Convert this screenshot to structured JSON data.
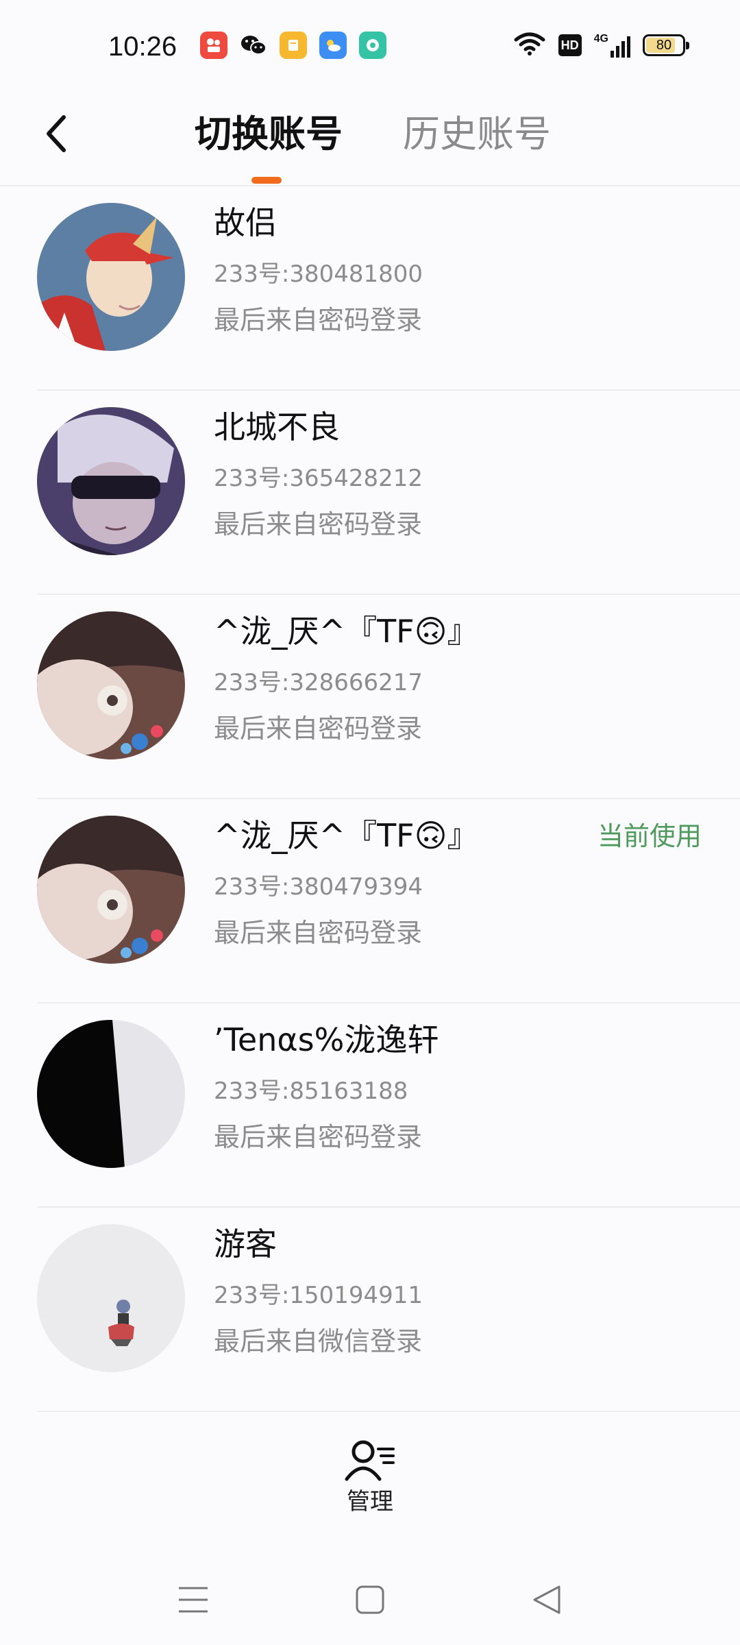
{
  "status_bar": {
    "time": "10:26",
    "network_label": "4G",
    "hd_label": "HD",
    "battery_level": "80",
    "app_icons": [
      "kuaishou-icon",
      "wechat-icon",
      "book-icon",
      "weather-icon",
      "message-icon"
    ]
  },
  "header": {
    "back_icon": "chevron-left-icon",
    "tabs": [
      {
        "label": "切换账号",
        "active": true
      },
      {
        "label": "历史账号",
        "active": false
      }
    ],
    "accent_color": "#f26a1b"
  },
  "accounts": [
    {
      "name": "故侣",
      "id_text": "233号:380481800",
      "login_text": "最后来自密码登录",
      "current": false
    },
    {
      "name": "北城不良",
      "id_text": "233号:365428212",
      "login_text": "最后来自密码登录",
      "current": false
    },
    {
      "name": "^泷_厌^『TF🙃』",
      "id_text": "233号:328666217",
      "login_text": "最后来自密码登录",
      "current": false
    },
    {
      "name": "^泷_厌^『TF🙃』",
      "id_text": "233号:380479394",
      "login_text": "最后来自密码登录",
      "current": true
    },
    {
      "name": "’Tenαs%泷逸轩",
      "id_text": "233号:85163188",
      "login_text": "最后来自密码登录",
      "current": false
    },
    {
      "name": "游客",
      "id_text": "233号:150194911",
      "login_text": "最后来自微信登录",
      "current": false
    }
  ],
  "current_label": "当前使用",
  "current_color": "#4e9a5d",
  "manage": {
    "label": "管理",
    "icon": "user-list-icon"
  },
  "nav_bar": {
    "icons": [
      "menu-icon",
      "home-square-icon",
      "back-triangle-icon"
    ]
  }
}
